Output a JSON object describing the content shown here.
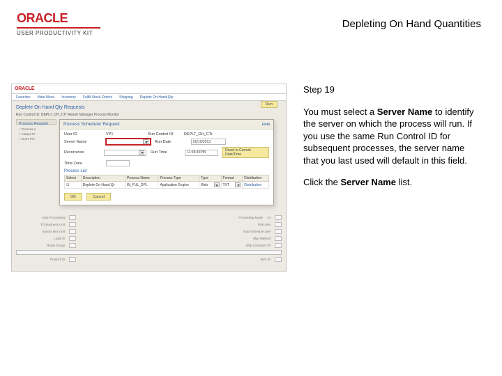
{
  "brand": {
    "logo_text": "ORACLE",
    "subline": "USER PRODUCTIVITY KIT"
  },
  "doc": {
    "title": "Depleting On Hand Quantities",
    "step_label": "Step 19"
  },
  "instructions": {
    "para1_a": "You must select a ",
    "para1_bold": "Server Name",
    "para1_b": " to identify the server on which the process will run. If you use the same Run Control ID for subsequent processes, the server name that you last used will default in this field.",
    "para2_a": "Click the ",
    "para2_bold": "Server Name",
    "para2_b": " list."
  },
  "shot": {
    "crumbs": [
      "Favorites",
      "Main Menu",
      "Inventory",
      "Fulfill Stock Orders",
      "Shipping",
      "Deplete On Hand Qty"
    ],
    "page_title": "Deplete On Hand Qty Requests",
    "run_control_line": "Run Control ID: DEPLT_OH_CTr     Report Manager     Process Monitor",
    "run_btn": "Run",
    "side": {
      "header": "Process Request",
      "opts": [
        "○ Process a",
        "○ Always Pr",
        "○ Don't Pro"
      ]
    }
  },
  "modal": {
    "title": "Process Scheduler Request",
    "help": "Help",
    "row1": {
      "userid_lbl": "User ID",
      "userid_val": "VP1",
      "rc_lbl": "Run Control ID:",
      "rc_val": "DEPLT_OH_CTr"
    },
    "row2": {
      "server_lbl": "Server Name",
      "server_val": "",
      "rundate_lbl": "Run Date",
      "rundate_val": "05/15/2013"
    },
    "row3": {
      "recur_lbl": "Recurrence",
      "recur_val": "",
      "runtime_lbl": "Run Time",
      "runtime_val": "11:45:49PM",
      "reset": "Reset to Current Date/Time"
    },
    "row4": {
      "tz_lbl": "Time Zone",
      "tz_val": ""
    },
    "list_title": "Process List",
    "table": {
      "headers": [
        "Select",
        "Description",
        "Process Name",
        "Process Type",
        "Type",
        "Format",
        "Distribution"
      ],
      "row": {
        "select": "☑",
        "desc": "Deplete On Hand Qt",
        "pname": "IN_FUL_DPL",
        "ptype": "Application Engine",
        "type": "Web",
        "format": "TXT",
        "dist": "Distribution"
      }
    },
    "ok": "OK",
    "cancel": "Cancel"
  },
  "under": {
    "rows": [
      {
        "l": "Auto-Processing",
        "r": "Processing Mode",
        "rv": "10"
      },
      {
        "l": "TO Business Unit",
        "r": "Pick Line"
      },
      {
        "l": "Source Bus Unit",
        "r": "Auto-Schedule Line"
      },
      {
        "l": "Load ID",
        "r": "Ship Method"
      },
      {
        "l": "Route Group",
        "r": "Ship Container ID"
      },
      {
        "l": "",
        "r": "",
        "bar": true
      },
      {
        "l": "Product ID",
        "r": "Item ID"
      }
    ]
  }
}
